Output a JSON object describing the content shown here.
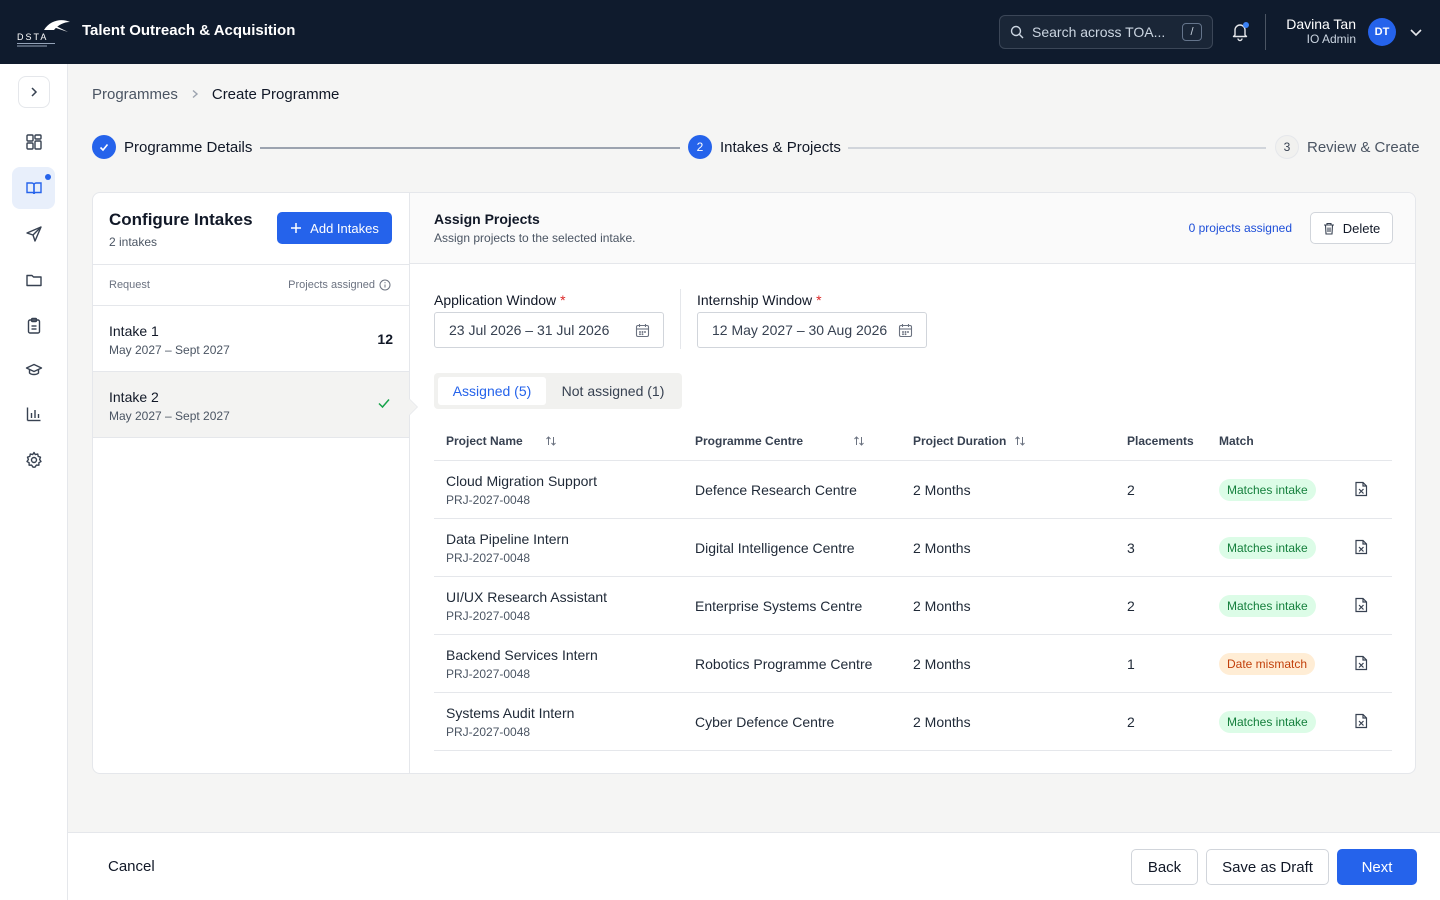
{
  "header": {
    "app_title": "Talent Outreach & Acquisition",
    "logo_text": "DSTA",
    "search_placeholder": "Search across TOA...",
    "search_shortcut": "/",
    "user_name": "Davina Tan",
    "user_role": "IO Admin",
    "user_initials": "DT"
  },
  "breadcrumb": {
    "parent": "Programmes",
    "current": "Create Programme"
  },
  "stepper": {
    "steps": [
      {
        "label": "Programme Details",
        "state": "complete"
      },
      {
        "label": "Intakes & Projects",
        "number": "2",
        "state": "active"
      },
      {
        "label": "Review & Create",
        "number": "3",
        "state": "upcoming"
      }
    ]
  },
  "intakes_panel": {
    "title": "Configure Intakes",
    "subtitle": "2 intakes",
    "add_button": "Add Intakes",
    "col_request": "Request",
    "col_assigned": "Projects assigned",
    "items": [
      {
        "name": "Intake 1",
        "dates": "May 2027 – Sept 2027",
        "count": "12"
      },
      {
        "name": "Intake 2",
        "dates": "May 2027 – Sept 2027",
        "count": ""
      }
    ]
  },
  "assign_panel": {
    "title": "Assign Projects",
    "subtitle": "Assign projects to the selected intake.",
    "assigned_link": "0 projects assigned",
    "delete_button": "Delete",
    "application_window_label": "Application Window",
    "application_window_value": "23 Jul 2026 – 31 Jul 2026",
    "internship_window_label": "Internship Window",
    "internship_window_value": "12 May 2027 – 30 Aug 2026",
    "required_mark": "*",
    "tab_assigned": "Assigned (5)",
    "tab_not_assigned": "Not assigned (1)"
  },
  "table": {
    "columns": {
      "project_name": "Project Name",
      "centre": "Programme Centre",
      "duration": "Project Duration",
      "placements": "Placements",
      "match": "Match"
    },
    "rows": [
      {
        "name": "Cloud Migration Support",
        "code": "PRJ-2027-0048",
        "centre": "Defence Research Centre",
        "duration": "2 Months",
        "placements": "2",
        "match": "Matches intake",
        "status": "ok"
      },
      {
        "name": "Data Pipeline Intern",
        "code": "PRJ-2027-0048",
        "centre": "Digital Intelligence Centre",
        "duration": "2 Months",
        "placements": "3",
        "match": "Matches intake",
        "status": "ok"
      },
      {
        "name": "UI/UX Research Assistant",
        "code": "PRJ-2027-0048",
        "centre": "Enterprise Systems Centre",
        "duration": "2 Months",
        "placements": "2",
        "match": "Matches intake",
        "status": "ok"
      },
      {
        "name": "Backend Services Intern",
        "code": "PRJ-2027-0048",
        "centre": "Robotics Programme Centre",
        "duration": "2 Months",
        "placements": "1",
        "match": "Date mismatch",
        "status": "warn"
      },
      {
        "name": "Systems Audit Intern",
        "code": "PRJ-2027-0048",
        "centre": "Cyber Defence Centre",
        "duration": "2 Months",
        "placements": "2",
        "match": "Matches intake",
        "status": "ok"
      }
    ]
  },
  "footer": {
    "cancel": "Cancel",
    "back": "Back",
    "save_draft": "Save as Draft",
    "next": "Next"
  },
  "colors": {
    "primary": "#2563eb",
    "topbar": "#0f1b2d",
    "match_ok_bg": "#dcfce7",
    "match_warn_bg": "#ffedd5"
  }
}
